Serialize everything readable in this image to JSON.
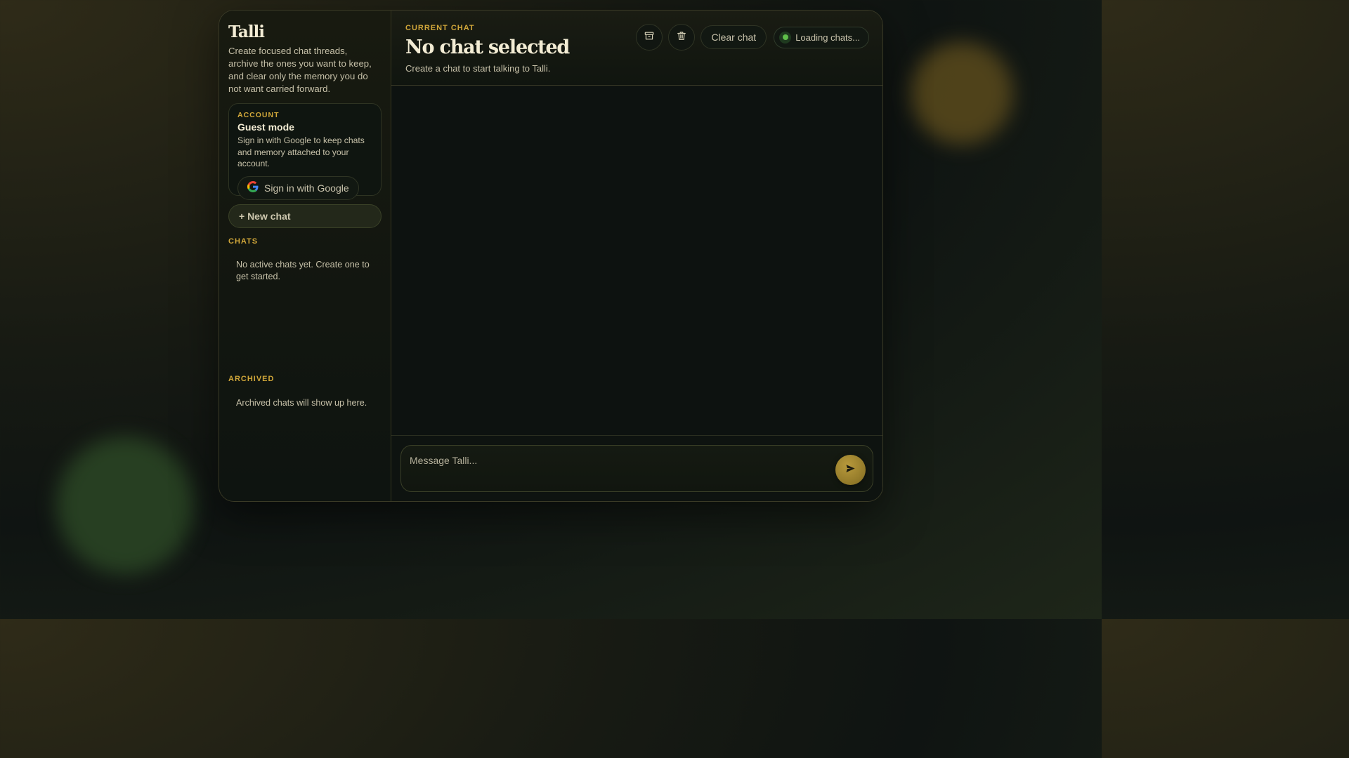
{
  "sidebar": {
    "brand": "Talli",
    "tagline": "Create focused chat threads, archive the ones you want to keep, and clear only the memory you do not want carried forward.",
    "account": {
      "eyebrow": "ACCOUNT",
      "title": "Guest mode",
      "description": "Sign in with Google to keep chats and memory attached to your account.",
      "google_button_label": "Sign in with Google"
    },
    "new_chat_label": "+ New chat",
    "chats": {
      "label": "CHATS",
      "empty_text": "No active chats yet. Create one to get started."
    },
    "archived": {
      "label": "ARCHIVED",
      "empty_text": "Archived chats will show up here."
    }
  },
  "main": {
    "eyebrow": "CURRENT CHAT",
    "title": "No chat selected",
    "subtitle": "Create a chat to start talking to Talli.",
    "actions": {
      "archive_icon": "archive-icon",
      "delete_icon": "trash-icon",
      "clear_label": "Clear chat",
      "status_text": "Loading chats..."
    },
    "composer": {
      "placeholder": "Message Talli...",
      "send_icon": "send-icon"
    }
  },
  "colors": {
    "accent_gold": "#d2a83a",
    "status_green": "#5fbf4a",
    "send_button": "#a88a32"
  }
}
